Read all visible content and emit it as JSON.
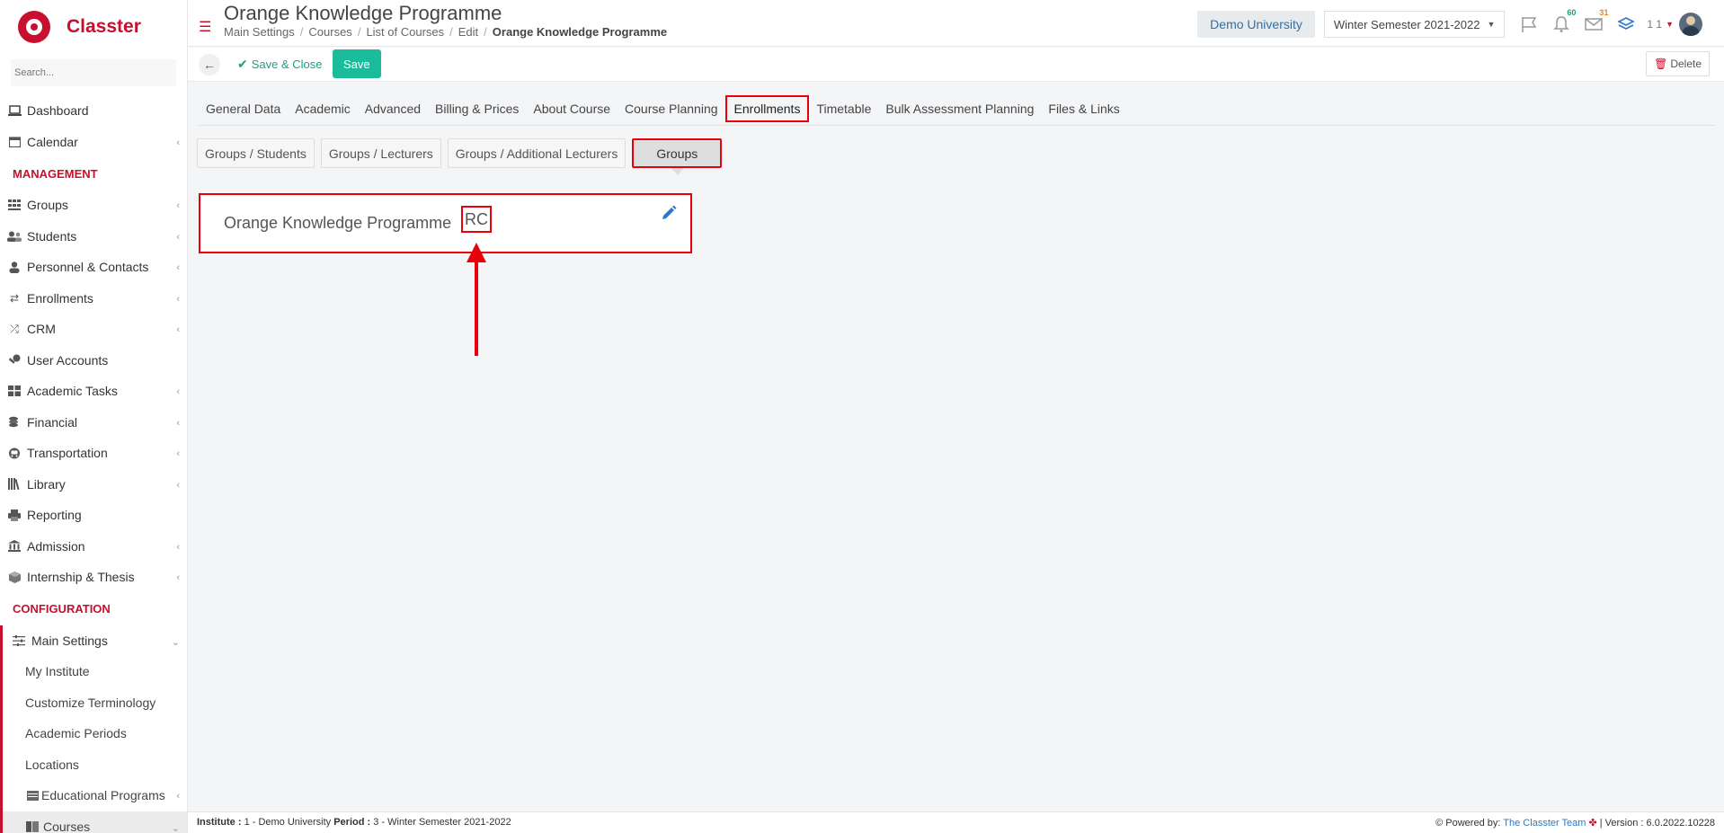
{
  "app": {
    "name": "Classter",
    "search_placeholder": "Search..."
  },
  "sidebar": {
    "items": [
      {
        "label": "Dashboard",
        "icon": "laptop-icon",
        "chevron": false
      },
      {
        "label": "Calendar",
        "icon": "calendar-icon",
        "chevron": true
      }
    ],
    "management_label": "MANAGEMENT",
    "management_items": [
      {
        "label": "Groups",
        "icon": "groups-icon",
        "chevron": true
      },
      {
        "label": "Students",
        "icon": "students-icon",
        "chevron": true
      },
      {
        "label": "Personnel & Contacts",
        "icon": "person-icon",
        "chevron": true
      },
      {
        "label": "Enrollments",
        "icon": "exchange-icon",
        "chevron": true
      },
      {
        "label": "CRM",
        "icon": "crm-icon",
        "chevron": true
      },
      {
        "label": "User Accounts",
        "icon": "key-icon",
        "chevron": false
      },
      {
        "label": "Academic Tasks",
        "icon": "tasks-icon",
        "chevron": true
      },
      {
        "label": "Financial",
        "icon": "coins-icon",
        "chevron": true
      },
      {
        "label": "Transportation",
        "icon": "bus-icon",
        "chevron": true
      },
      {
        "label": "Library",
        "icon": "library-icon",
        "chevron": true
      },
      {
        "label": "Reporting",
        "icon": "printer-icon",
        "chevron": false
      },
      {
        "label": "Admission",
        "icon": "institution-icon",
        "chevron": true
      },
      {
        "label": "Internship & Thesis",
        "icon": "cube-icon",
        "chevron": true
      }
    ],
    "configuration_label": "CONFIGURATION",
    "main_settings_label": "Main Settings",
    "config_sub_items": [
      {
        "label": "My Institute"
      },
      {
        "label": "Customize Terminology"
      },
      {
        "label": "Academic Periods"
      },
      {
        "label": "Locations"
      },
      {
        "label": "Educational Programs"
      },
      {
        "label": "Courses"
      }
    ]
  },
  "header": {
    "title": "Orange Knowledge Programme",
    "breadcrumb": [
      "Main Settings",
      "Courses",
      "List of Courses",
      "Edit"
    ],
    "breadcrumb_current": "Orange Knowledge Programme",
    "university": "Demo University",
    "semester": "Winter Semester 2021-2022",
    "notifications_count": "60",
    "messages_count": "31",
    "user_id": "1 1"
  },
  "actions": {
    "save_close_label": "Save & Close",
    "save_label": "Save",
    "delete_label": "Delete"
  },
  "tabs": [
    {
      "label": "General Data"
    },
    {
      "label": "Academic"
    },
    {
      "label": "Advanced"
    },
    {
      "label": "Billing & Prices"
    },
    {
      "label": "About Course"
    },
    {
      "label": "Course Planning"
    },
    {
      "label": "Enrollments",
      "active": true
    },
    {
      "label": "Timetable"
    },
    {
      "label": "Bulk Assessment Planning"
    },
    {
      "label": "Files & Links"
    }
  ],
  "subtabs": [
    {
      "label": "Groups / Students"
    },
    {
      "label": "Groups / Lecturers"
    },
    {
      "label": "Groups / Additional Lecturers"
    },
    {
      "label": "Groups",
      "active": true
    }
  ],
  "group_card": {
    "name": "Orange Knowledge Programme",
    "code": "RC"
  },
  "footer": {
    "institute_label": "Institute :",
    "institute_value": "1 - Demo University",
    "period_label": "Period :",
    "period_value": "3 - Winter Semester 2021-2022",
    "powered_by": "Powered by:",
    "team": "The Classter Team",
    "version": "| Version : 6.0.2022.10228"
  },
  "colors": {
    "brand": "#c8102e",
    "accent_green": "#1abc9c",
    "highlight_red": "#e8000b",
    "link_blue": "#2e78c4"
  }
}
